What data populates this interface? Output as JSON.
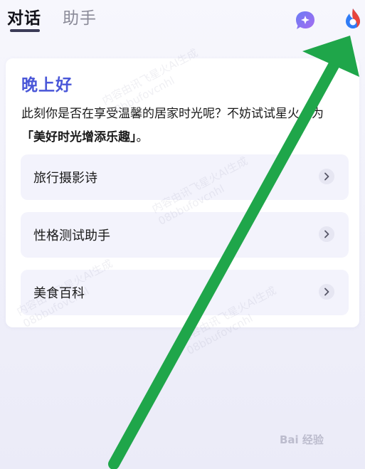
{
  "tabs": {
    "active": "对话",
    "inactive": "助手"
  },
  "header": {
    "icons": [
      "chat-plus-icon",
      "app-logo-icon"
    ]
  },
  "card": {
    "greeting": "晚上好",
    "intro_text": "此刻你是否在享受温馨的居家时光呢？不妨试试星火，为",
    "intro_highlight": "「美好时光增添乐趣」",
    "intro_end": "。",
    "suggestions": [
      {
        "label": "旅行摄影诗"
      },
      {
        "label": "性格测试助手"
      },
      {
        "label": "美食百科"
      }
    ]
  },
  "watermarks": [
    {
      "line1": "内容由讯飞星火AI生成",
      "line2": "08bbufovcnhl"
    },
    {
      "line1": "内容由讯飞星火AI生成",
      "line2": "08bbufovcnhl"
    },
    {
      "line1": "内容由讯飞星火AI生成",
      "line2": "08bbufovcnhl"
    },
    {
      "line1": "内容由讯飞星火AI生成",
      "line2": "08bbufovcnhl"
    }
  ],
  "baidu": "Bai 经验",
  "colors": {
    "accent": "#4a57d8",
    "arrow": "#1fa64a"
  }
}
